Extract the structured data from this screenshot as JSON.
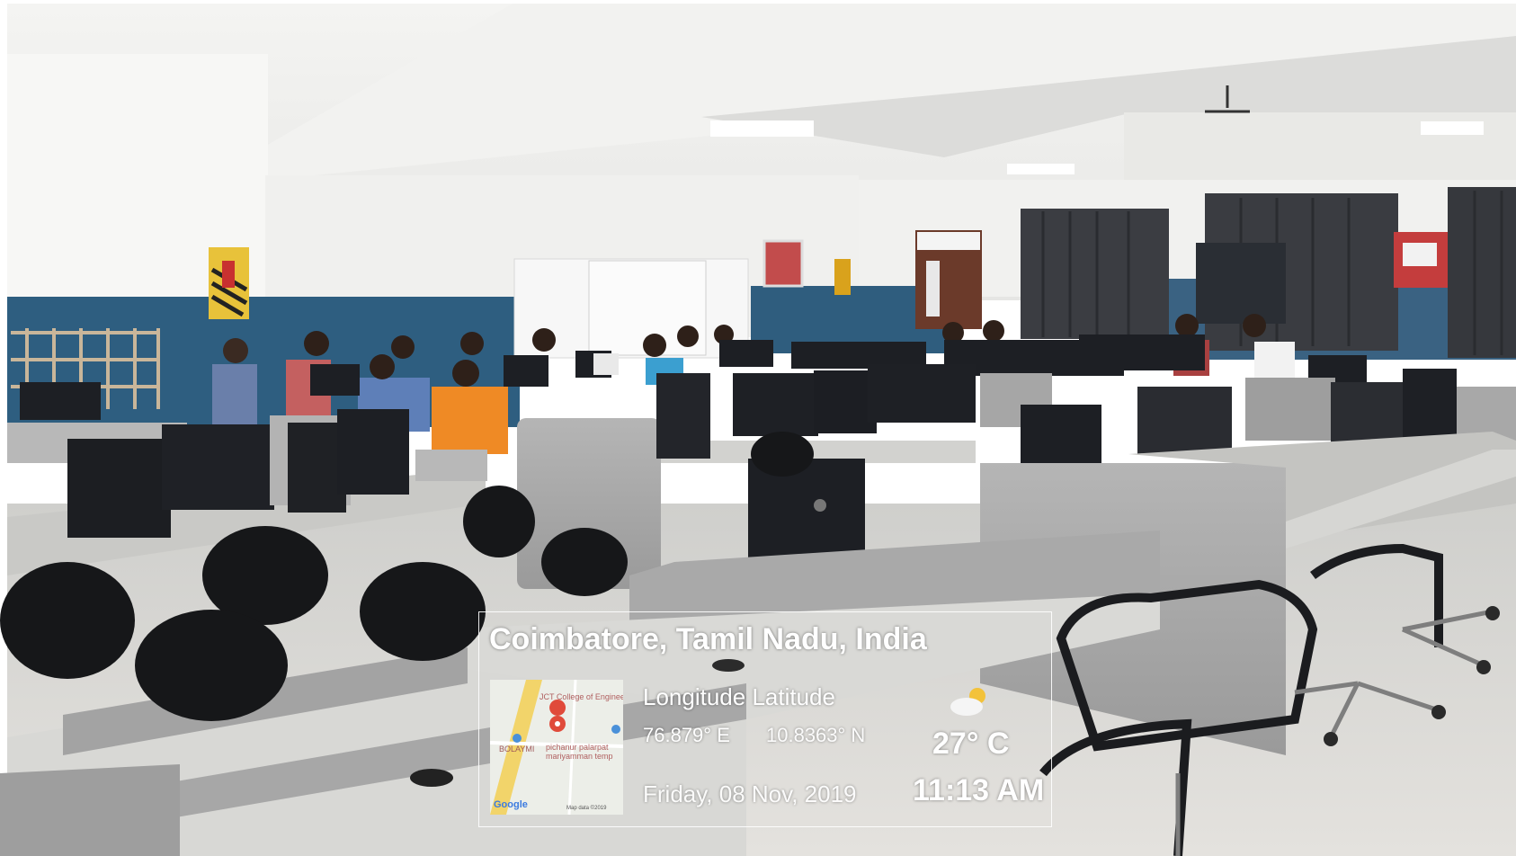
{
  "photo": {
    "subject": "computer lab"
  },
  "gps_stamp": {
    "place": "Coimbatore, Tamil Nadu, India",
    "heading": "Longitude Latitude",
    "longitude": "76.879° E",
    "latitude": "10.8363° N",
    "temperature": "27° C",
    "date": "Friday, 08 Nov, 2019",
    "time": "11:13 AM",
    "weather_icon": "partly-cloudy-icon",
    "map": {
      "label_college": "JCT College of Engineering and...",
      "label_left": "BOLAYMI",
      "label_temple": "pichanur palarpat mariyamman temp",
      "brand": "Google",
      "credit": "Map data ©2019"
    }
  }
}
